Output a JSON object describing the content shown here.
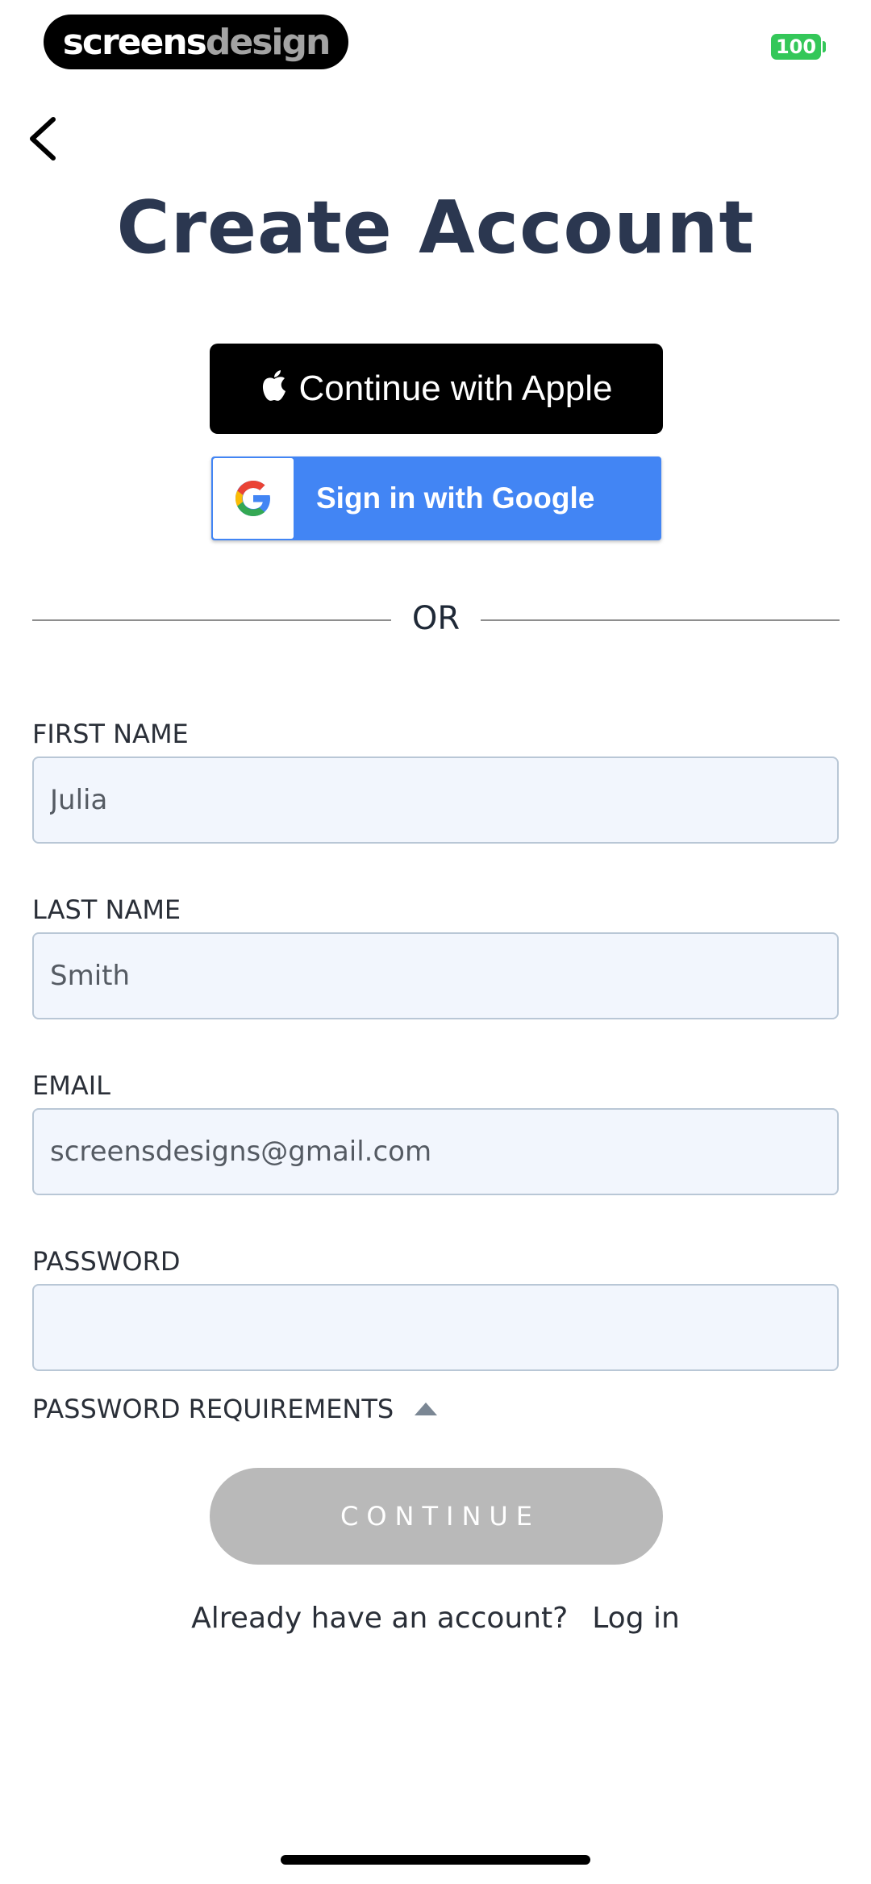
{
  "status_bar": {
    "brand_part1": "screens",
    "brand_part2": "design",
    "battery": "100"
  },
  "header": {
    "back_icon": "chevron-left-icon",
    "title": "Create Account"
  },
  "social": {
    "apple_label": "Continue with Apple",
    "apple_icon": "apple-icon",
    "google_label": "Sign in with Google",
    "google_icon": "google-icon"
  },
  "divider": {
    "text": "OR"
  },
  "form": {
    "first_name": {
      "label": "FIRST NAME",
      "value": "Julia"
    },
    "last_name": {
      "label": "LAST NAME",
      "value": "Smith"
    },
    "email": {
      "label": "EMAIL",
      "value": "screensdesigns@gmail.com"
    },
    "password": {
      "label": "PASSWORD",
      "value": ""
    },
    "password_requirements": "PASSWORD REQUIREMENTS",
    "password_requirements_icon": "caret-up-icon"
  },
  "actions": {
    "continue_label": "CONTINUE",
    "already_text": "Already have an account?",
    "login_label": "Log in"
  },
  "colors": {
    "title": "#2b3750",
    "google_blue": "#4285f4",
    "input_bg": "#f2f6fd",
    "input_border": "#b9c7d6",
    "continue_disabled": "#b9b9b9",
    "battery_green": "#34c759"
  }
}
